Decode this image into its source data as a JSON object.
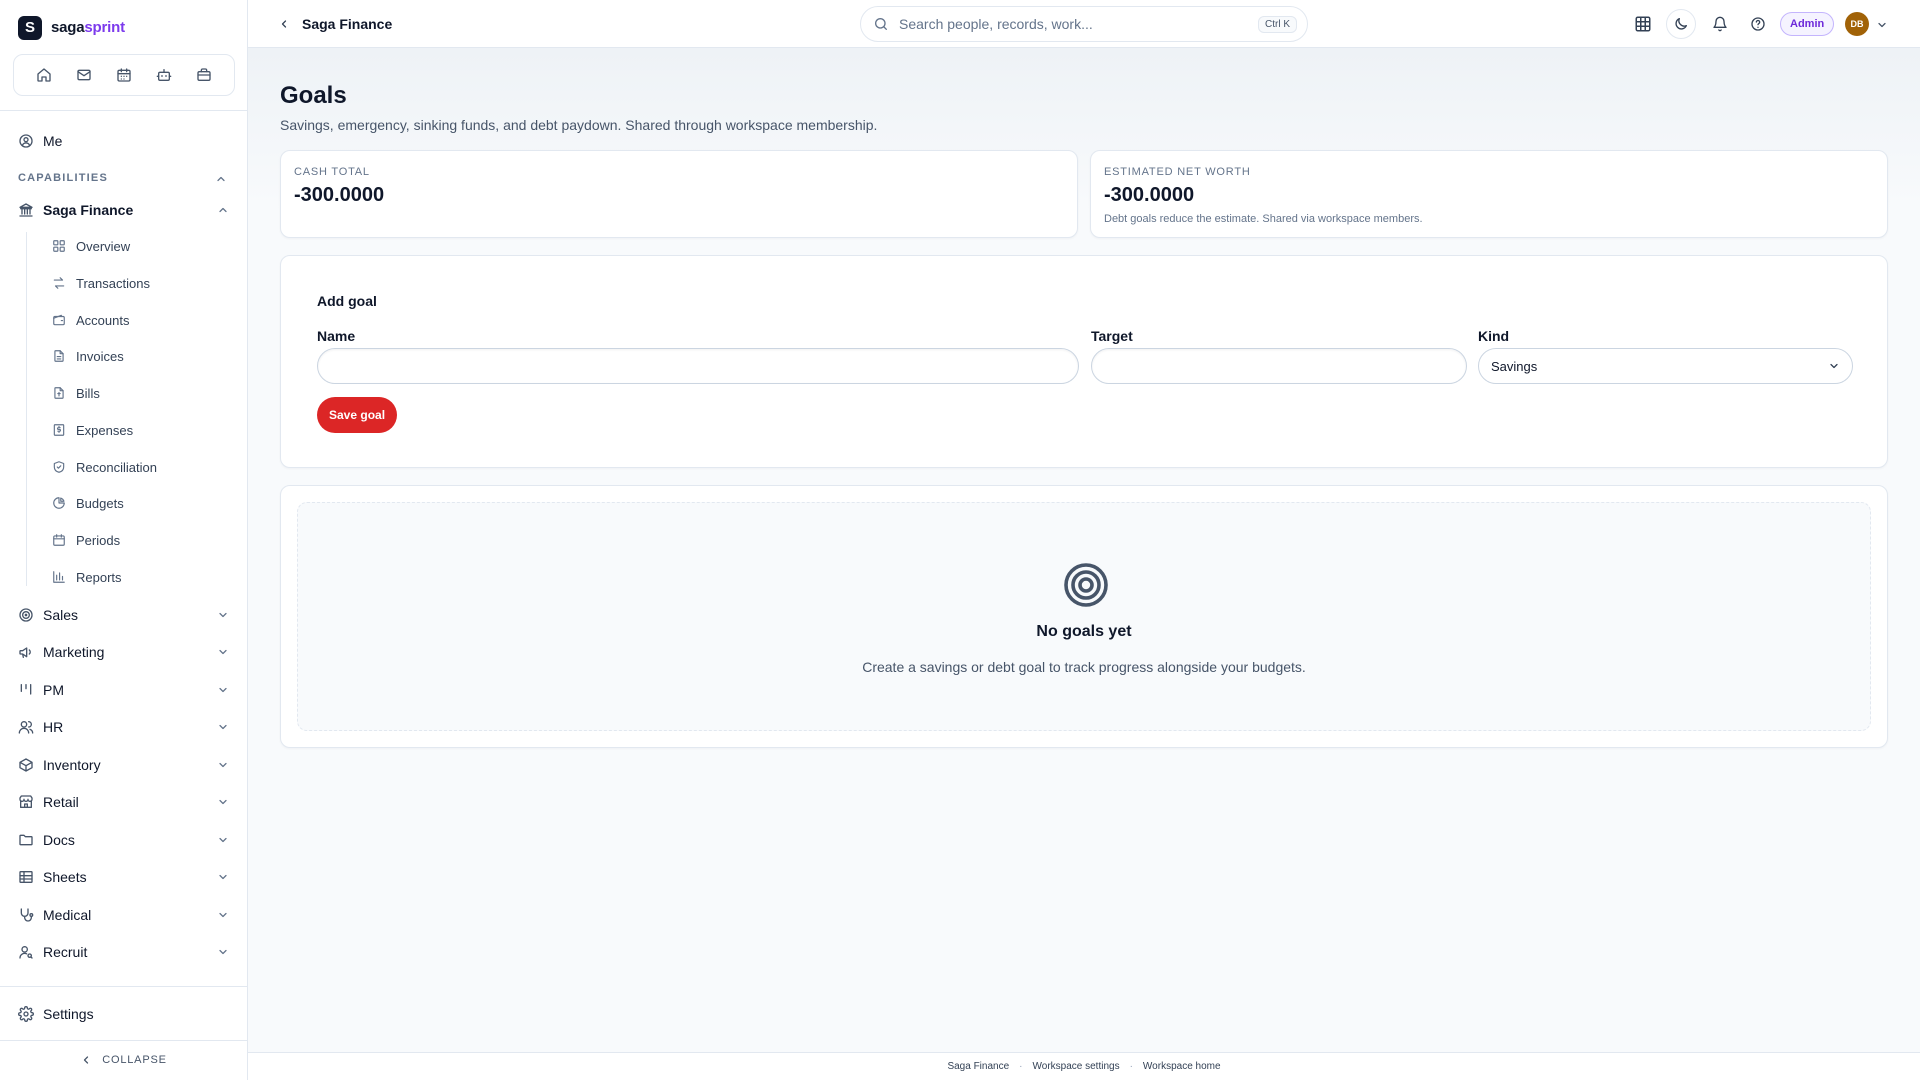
{
  "brand": {
    "logo_letter": "S",
    "name_part1": "saga",
    "name_part2": "sprint",
    "accent_color": "#7c3aed"
  },
  "quickbar": {
    "icons": [
      "home-icon",
      "mail-icon",
      "calendar-icon",
      "bot-icon",
      "briefcase-icon"
    ]
  },
  "sidebar": {
    "me_label": "Me",
    "capabilities_label": "CAPABILITIES",
    "active_section": "Saga Finance",
    "finance_items": [
      {
        "label": "Overview",
        "icon": "grid-icon"
      },
      {
        "label": "Transactions",
        "icon": "arrows-icon"
      },
      {
        "label": "Accounts",
        "icon": "wallet-icon"
      },
      {
        "label": "Invoices",
        "icon": "document-icon"
      },
      {
        "label": "Bills",
        "icon": "receipt-icon"
      },
      {
        "label": "Expenses",
        "icon": "expense-icon"
      },
      {
        "label": "Reconciliation",
        "icon": "shield-check-icon"
      },
      {
        "label": "Budgets",
        "icon": "pie-icon"
      },
      {
        "label": "Periods",
        "icon": "calendar-icon"
      },
      {
        "label": "Reports",
        "icon": "bar-chart-icon"
      }
    ],
    "sections": [
      {
        "label": "Sales",
        "icon": "target-icon"
      },
      {
        "label": "Marketing",
        "icon": "megaphone-icon"
      },
      {
        "label": "PM",
        "icon": "kanban-icon"
      },
      {
        "label": "HR",
        "icon": "users-icon"
      },
      {
        "label": "Inventory",
        "icon": "box-icon"
      },
      {
        "label": "Retail",
        "icon": "store-icon"
      },
      {
        "label": "Docs",
        "icon": "folder-icon"
      },
      {
        "label": "Sheets",
        "icon": "table-icon"
      },
      {
        "label": "Medical",
        "icon": "stethoscope-icon"
      },
      {
        "label": "Recruit",
        "icon": "user-search-icon"
      }
    ],
    "settings_label": "Settings",
    "collapse_label": "COLLAPSE"
  },
  "topbar": {
    "breadcrumb": "Saga Finance",
    "search_placeholder": "Search people, records, work...",
    "search_shortcut": "Ctrl K",
    "role_badge": "Admin",
    "avatar_initials": "DB"
  },
  "page": {
    "title": "Goals",
    "subtitle": "Savings, emergency, sinking funds, and debt paydown. Shared through workspace membership."
  },
  "stats": {
    "cash_total_label": "CASH TOTAL",
    "cash_total_value": "-300.0000",
    "net_worth_label": "ESTIMATED NET WORTH",
    "net_worth_value": "-300.0000",
    "net_worth_note": "Debt goals reduce the estimate. Shared via workspace members."
  },
  "form": {
    "title": "Add goal",
    "name_label": "Name",
    "name_value": "",
    "target_label": "Target",
    "target_value": "",
    "kind_label": "Kind",
    "kind_selected": "Savings",
    "save_label": "Save goal",
    "save_color": "#dc2626"
  },
  "empty_state": {
    "title": "No goals yet",
    "text": "Create a savings or debt goal to track progress alongside your budgets."
  },
  "footer": {
    "links": [
      "Saga Finance",
      "Workspace settings",
      "Workspace home"
    ]
  }
}
